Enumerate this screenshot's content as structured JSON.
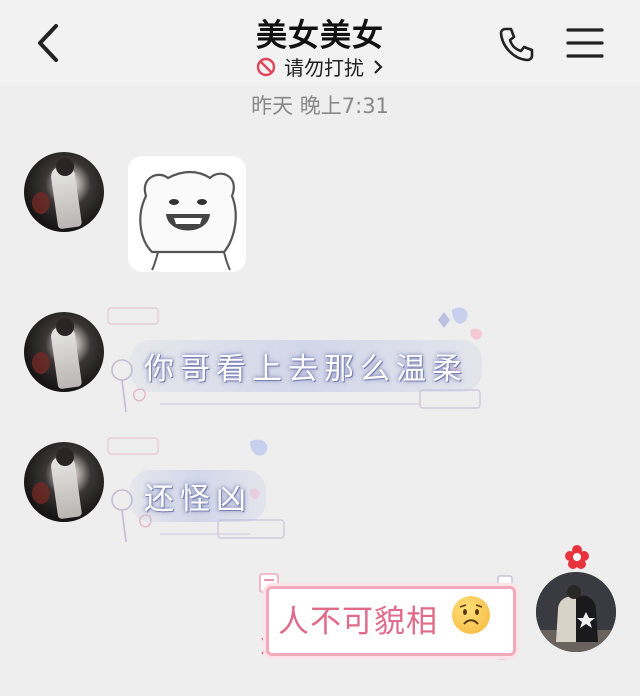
{
  "header": {
    "title": "美女美女",
    "subtitle": "请勿打扰",
    "subtitle_icon": "do-not-disturb-icon",
    "back_icon": "back-chevron-icon",
    "call_icon": "phone-icon",
    "menu_icon": "menu-icon"
  },
  "chat": {
    "timestamp": "昨天 晚上7:31",
    "messages": [
      {
        "side": "left",
        "type": "sticker",
        "sticker": "bear-face-sticker"
      },
      {
        "side": "left",
        "type": "text",
        "text": "你哥看上去那么温柔"
      },
      {
        "side": "left",
        "type": "text",
        "text": "还怪凶"
      },
      {
        "side": "right",
        "type": "text",
        "text": "人不可貌相",
        "emoji": "sad-face-emoji"
      }
    ]
  },
  "colors": {
    "background": "#eeeeee",
    "header_bg": "#f2f2f2",
    "bubble_border": "#f2a9ba",
    "bubble_text": "#e06a8a",
    "glow_text": "#7f86b8"
  }
}
